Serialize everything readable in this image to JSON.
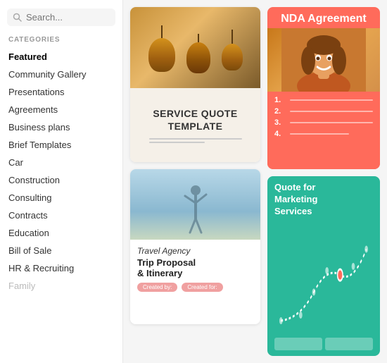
{
  "sidebar": {
    "search": {
      "placeholder": "Search..."
    },
    "categories_label": "CATEGORIES",
    "items": [
      {
        "id": "featured",
        "label": "Featured",
        "active": true,
        "disabled": false
      },
      {
        "id": "community-gallery",
        "label": "Community Gallery",
        "active": false,
        "disabled": false
      },
      {
        "id": "presentations",
        "label": "Presentations",
        "active": false,
        "disabled": false
      },
      {
        "id": "agreements",
        "label": "Agreements",
        "active": false,
        "disabled": false
      },
      {
        "id": "business-plans",
        "label": "Business plans",
        "active": false,
        "disabled": false
      },
      {
        "id": "brief-templates",
        "label": "Brief Templates",
        "active": false,
        "disabled": false
      },
      {
        "id": "car",
        "label": "Car",
        "active": false,
        "disabled": false
      },
      {
        "id": "construction",
        "label": "Construction",
        "active": false,
        "disabled": false
      },
      {
        "id": "consulting",
        "label": "Consulting",
        "active": false,
        "disabled": false
      },
      {
        "id": "contracts",
        "label": "Contracts",
        "active": false,
        "disabled": false
      },
      {
        "id": "education",
        "label": "Education",
        "active": false,
        "disabled": false
      },
      {
        "id": "bill-of-sale",
        "label": "Bill of Sale",
        "active": false,
        "disabled": false
      },
      {
        "id": "hr-recruiting",
        "label": "HR & Recruiting",
        "active": false,
        "disabled": false
      },
      {
        "id": "family",
        "label": "Family",
        "active": false,
        "disabled": true
      }
    ]
  },
  "cards": {
    "service_quote": {
      "title": "SERVICE QUOTE\nTEMPLATE"
    },
    "travel": {
      "title_italic": "Travel Agency",
      "title_main": "Trip Proposal\n& Itinerary",
      "badge1": "Created by:",
      "badge2": "Created for:"
    },
    "nda": {
      "title": "NDA Agreement",
      "list": [
        "1.",
        "2.",
        "3.",
        "4."
      ]
    },
    "quote_marketing": {
      "title": "Quote for\nMarketing\nServices"
    }
  }
}
